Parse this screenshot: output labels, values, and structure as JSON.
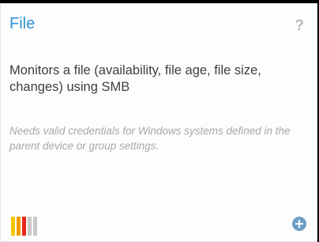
{
  "card": {
    "title": "File",
    "help_icon": "?",
    "description": "Monitors a file (availability, file age, file size, changes) using SMB",
    "note": "Needs valid credentials for Windows systems defined in the parent device or group settings.",
    "rating": {
      "icon": "performance-impact-bars",
      "bar_colors": [
        "#f5c400",
        "#f29b00",
        "#e8261a",
        "#c8c8c8",
        "#c8c8c8"
      ]
    },
    "add_icon": "plus-circle-icon",
    "colors": {
      "title": "#2e94d6",
      "add_button": "#6b9fc6"
    }
  }
}
